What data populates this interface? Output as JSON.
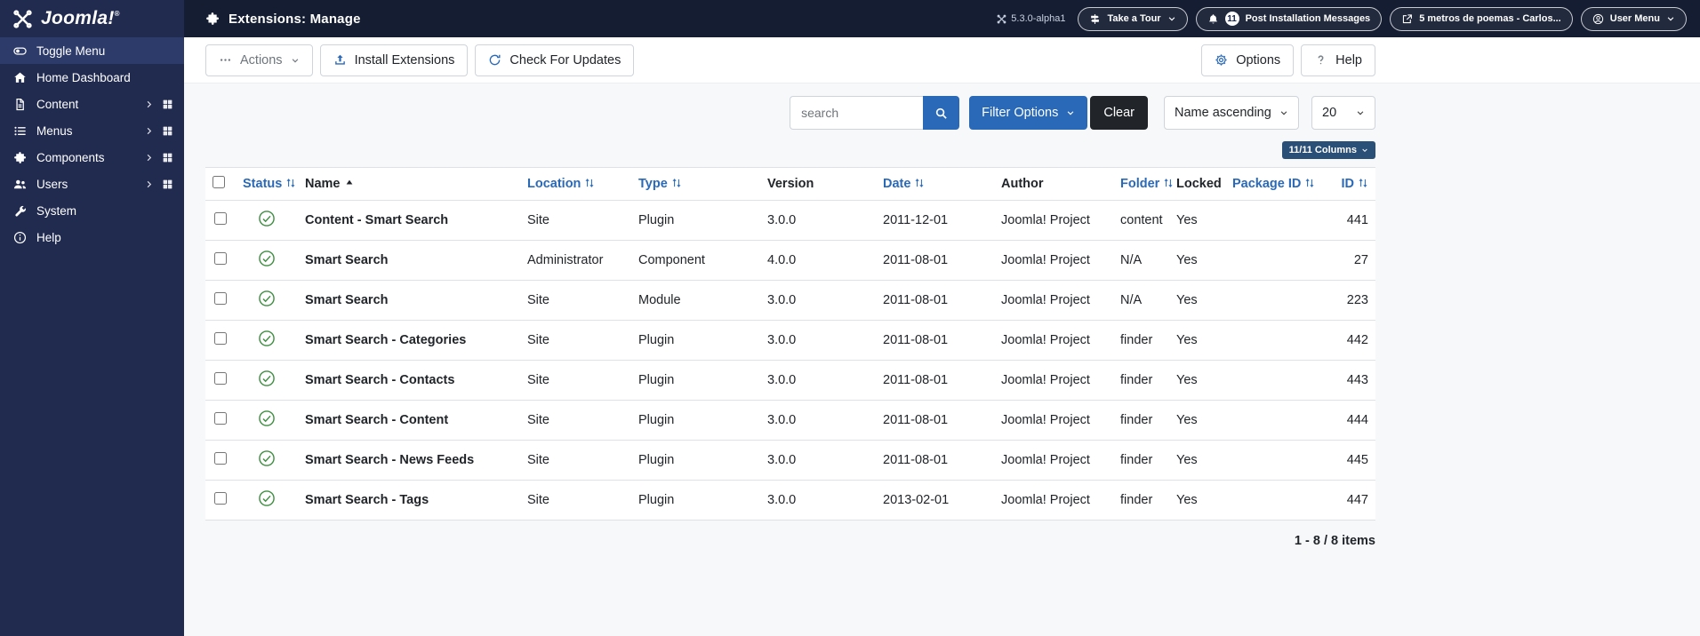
{
  "app": {
    "logo_text": "Joomla!",
    "logo_trademark": "®",
    "version": "5.3.0-alpha1"
  },
  "colors": {
    "accent": "#2a69b8",
    "header_bg": "#151d32",
    "sidebar_bg": "#212b50",
    "sidebar_active": "#2d3b6b",
    "content_bg": "#f7f8fa",
    "status_green": "#3e8e41",
    "dark_button": "#212529",
    "columns_badge": "#2b5078"
  },
  "header": {
    "title": "Extensions: Manage",
    "pills": [
      {
        "id": "take-a-tour",
        "label": "Take a Tour",
        "icon": "map-signs",
        "caret": true
      },
      {
        "id": "post-installation-messages",
        "label": "Post Installation Messages",
        "icon": "bell",
        "badge": "11"
      },
      {
        "id": "site-preview",
        "label": "5 metros de poemas - Carlos...",
        "icon": "external-link"
      },
      {
        "id": "user-menu",
        "label": "User Menu",
        "icon": "user-circle",
        "caret": true
      }
    ]
  },
  "sidebar": {
    "items": [
      {
        "id": "toggle-menu",
        "label": "Toggle Menu",
        "icon": "toggle-menu",
        "active": true
      },
      {
        "id": "home-dashboard",
        "label": "Home Dashboard",
        "icon": "home"
      },
      {
        "id": "content",
        "label": "Content",
        "icon": "file",
        "expandable": true,
        "dashboard": true
      },
      {
        "id": "menus",
        "label": "Menus",
        "icon": "list",
        "expandable": true,
        "dashboard": true
      },
      {
        "id": "components",
        "label": "Components",
        "icon": "puzzle",
        "expandable": true,
        "dashboard": true
      },
      {
        "id": "users",
        "label": "Users",
        "icon": "users",
        "expandable": true,
        "dashboard": true
      },
      {
        "id": "system",
        "label": "System",
        "icon": "wrench"
      },
      {
        "id": "help",
        "label": "Help",
        "icon": "info-circle"
      }
    ]
  },
  "toolbar": {
    "buttons_left": [
      {
        "id": "actions",
        "label": "Actions",
        "icon": "ellipsis",
        "caret": true,
        "muted": true
      },
      {
        "id": "install-extensions",
        "label": "Install Extensions",
        "icon": "upload"
      },
      {
        "id": "check-for-updates",
        "label": "Check For Updates",
        "icon": "sync"
      }
    ],
    "buttons_right": [
      {
        "id": "options",
        "label": "Options",
        "icon": "gear"
      },
      {
        "id": "help",
        "label": "Help",
        "icon": "question"
      }
    ]
  },
  "filters": {
    "search_placeholder": "search",
    "filter_options_label": "Filter Options",
    "clear_label": "Clear",
    "sort_selected": "Name ascending",
    "limit_selected": "20",
    "columns_button_label": "11/11 Columns"
  },
  "table": {
    "columns": [
      {
        "key": "status",
        "label": "Status",
        "sortable": true
      },
      {
        "key": "name",
        "label": "Name",
        "sortable": true,
        "sorted": "asc"
      },
      {
        "key": "location",
        "label": "Location",
        "sortable": true
      },
      {
        "key": "type",
        "label": "Type",
        "sortable": true
      },
      {
        "key": "version",
        "label": "Version",
        "sortable": false
      },
      {
        "key": "date",
        "label": "Date",
        "sortable": true
      },
      {
        "key": "author",
        "label": "Author",
        "sortable": false
      },
      {
        "key": "folder",
        "label": "Folder",
        "sortable": true
      },
      {
        "key": "locked",
        "label": "Locked",
        "sortable": false
      },
      {
        "key": "package_id",
        "label": "Package ID",
        "sortable": true
      },
      {
        "key": "id",
        "label": "ID",
        "sortable": true
      }
    ],
    "rows": [
      {
        "status": "enabled",
        "name": "Content - Smart Search",
        "location": "Site",
        "type": "Plugin",
        "version": "3.0.0",
        "date": "2011-12-01",
        "author": "Joomla! Project",
        "folder": "content",
        "locked": "Yes",
        "package_id": "",
        "id": "441"
      },
      {
        "status": "enabled",
        "name": "Smart Search",
        "location": "Administrator",
        "type": "Component",
        "version": "4.0.0",
        "date": "2011-08-01",
        "author": "Joomla! Project",
        "folder": "N/A",
        "locked": "Yes",
        "package_id": "",
        "id": "27"
      },
      {
        "status": "enabled",
        "name": "Smart Search",
        "location": "Site",
        "type": "Module",
        "version": "3.0.0",
        "date": "2011-08-01",
        "author": "Joomla! Project",
        "folder": "N/A",
        "locked": "Yes",
        "package_id": "",
        "id": "223"
      },
      {
        "status": "enabled",
        "name": "Smart Search - Categories",
        "location": "Site",
        "type": "Plugin",
        "version": "3.0.0",
        "date": "2011-08-01",
        "author": "Joomla! Project",
        "folder": "finder",
        "locked": "Yes",
        "package_id": "",
        "id": "442"
      },
      {
        "status": "enabled",
        "name": "Smart Search - Contacts",
        "location": "Site",
        "type": "Plugin",
        "version": "3.0.0",
        "date": "2011-08-01",
        "author": "Joomla! Project",
        "folder": "finder",
        "locked": "Yes",
        "package_id": "",
        "id": "443"
      },
      {
        "status": "enabled",
        "name": "Smart Search - Content",
        "location": "Site",
        "type": "Plugin",
        "version": "3.0.0",
        "date": "2011-08-01",
        "author": "Joomla! Project",
        "folder": "finder",
        "locked": "Yes",
        "package_id": "",
        "id": "444"
      },
      {
        "status": "enabled",
        "name": "Smart Search - News Feeds",
        "location": "Site",
        "type": "Plugin",
        "version": "3.0.0",
        "date": "2011-08-01",
        "author": "Joomla! Project",
        "folder": "finder",
        "locked": "Yes",
        "package_id": "",
        "id": "445"
      },
      {
        "status": "enabled",
        "name": "Smart Search - Tags",
        "location": "Site",
        "type": "Plugin",
        "version": "3.0.0",
        "date": "2013-02-01",
        "author": "Joomla! Project",
        "folder": "finder",
        "locked": "Yes",
        "package_id": "",
        "id": "447"
      }
    ]
  },
  "footer": {
    "count_label": "1 - 8 / 8 items"
  }
}
